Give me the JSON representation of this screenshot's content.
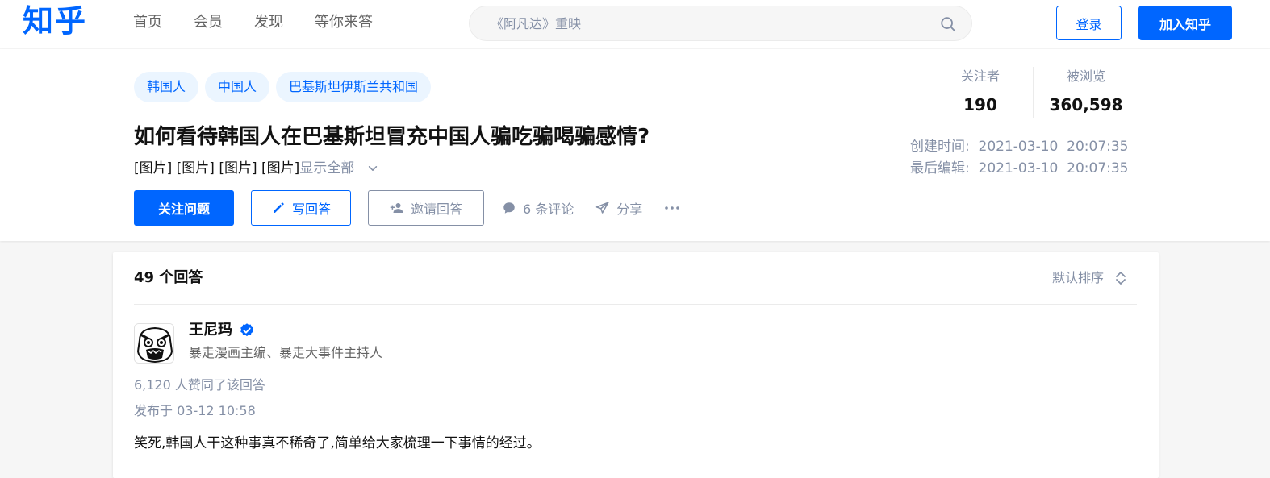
{
  "brand": {
    "logo": "知乎",
    "accent": "#0066ff"
  },
  "nav": {
    "items": [
      "首页",
      "会员",
      "发现",
      "等你来答"
    ]
  },
  "search": {
    "placeholder": "《阿凡达》重映",
    "icon": "search-icon"
  },
  "auth": {
    "login": "登录",
    "join": "加入知乎"
  },
  "question": {
    "topics": [
      "韩国人",
      "中国人",
      "巴基斯坦伊斯兰共和国"
    ],
    "title": "如何看待韩国人在巴基斯坦冒充中国人骗吃骗喝骗感情?",
    "detail": "[图片] [图片] [图片] [图片]",
    "show_all": "显示全部",
    "actions": {
      "follow": "关注问题",
      "write": "写回答",
      "invite": "邀请回答",
      "comments": "6 条评论",
      "share": "分享"
    },
    "stats": {
      "followers_label": "关注者",
      "followers": "190",
      "views_label": "被浏览",
      "views": "360,598"
    },
    "created": "创建时间:  2021-03-10  20:07:35",
    "edited": "最后编辑:  2021-03-10  20:07:35"
  },
  "answers": {
    "count": "49 个回答",
    "sort": "默认排序",
    "first": {
      "author": "王尼玛",
      "bio": "暴走漫画主编、暴走大事件主持人",
      "votes": "6,120 人赞同了该回答",
      "published": "发布于 03-12 10:58",
      "content": "笑死,韩国人干这种事真不稀奇了,简单给大家梳理一下事情的经过。"
    }
  }
}
